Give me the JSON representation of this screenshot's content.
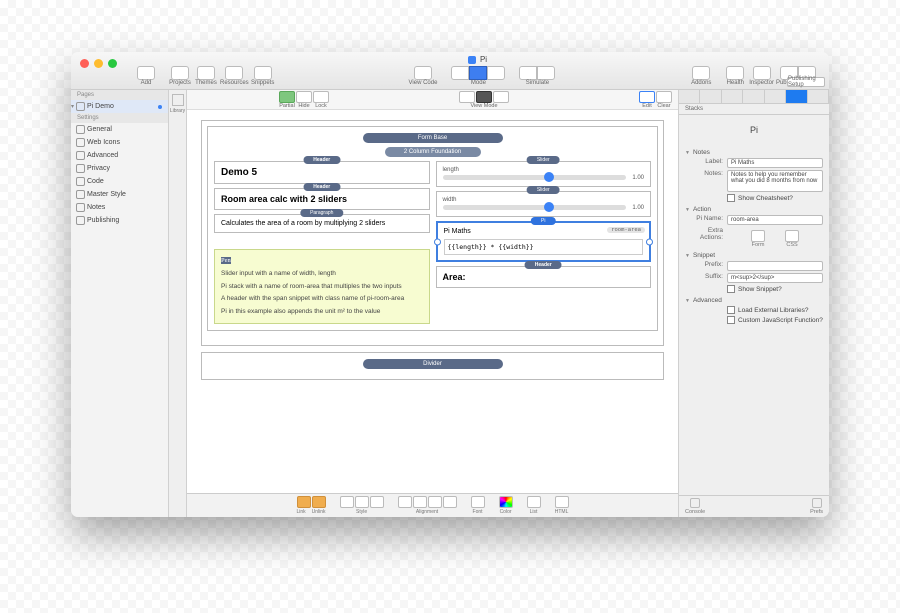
{
  "title": "Pi",
  "toolbar_left": {
    "add": "Add",
    "projects": "Projects",
    "themes": "Themes",
    "resources": "Resources",
    "snippets": "Snippets"
  },
  "toolbar_center": {
    "viewcode": "View Code",
    "mode": "Mode",
    "simulate": "Simulate"
  },
  "toolbar_right": {
    "addons": "Addons",
    "health": "Health",
    "inspector": "Inspector",
    "pubset": "Publishing Setup",
    "publish": "Publish"
  },
  "topright_tabs": [
    "Publishing Setup",
    "Publishing Setup"
  ],
  "sidebar": {
    "pages_hd": "Pages",
    "page_item": "Pi Demo",
    "settings_hd": "Settings",
    "items": [
      "General",
      "Web Icons",
      "Advanced",
      "Privacy",
      "Code",
      "Master Style",
      "Notes",
      "Publishing"
    ]
  },
  "library_label": "Library",
  "canvas_toolbar": {
    "partial": "Partial",
    "hide": "Hide",
    "lock": "Lock",
    "viewmode": "View Mode",
    "edit": "Edit",
    "clear": "Clear"
  },
  "stacks_label": "Stacks",
  "page": {
    "form_base": "Form Base",
    "two_col": "2 Column Foundation",
    "headers": {
      "h": "Header",
      "p": "Paragraph",
      "slider": "Slider",
      "pi": "Pi",
      "pen": "Pen",
      "div": "Divider"
    },
    "demo_heading": "Demo 5",
    "subheading": "Room area calc with 2 sliders",
    "paragraph": "Calculates the area of a room by multiplying 2 sliders",
    "slider1": {
      "label": "length",
      "value": "1.00"
    },
    "slider2": {
      "label": "width",
      "value": "1.00"
    },
    "pi_block": {
      "title": "Pi Maths",
      "badge": "room-area",
      "expr": "{{length}} * {{width}}"
    },
    "area_heading": "Area:",
    "pen_lines": [
      "Slider input with a name of width, length",
      "Pi stack with a name of room-area that multiples the two inputs",
      "A header with the span snippet with class name of pi-room-area",
      "Pi in this example also appends the unit m² to the value"
    ]
  },
  "stylebar": {
    "link": "Link",
    "unlink": "Unlink",
    "style": "Style",
    "alignment": "Alignment",
    "font": "Font",
    "color": "Color",
    "list": "List",
    "html": "HTML"
  },
  "inspector": {
    "title": "Pi",
    "sections": {
      "notes": "Notes",
      "action": "Action",
      "snippet": "Snippet",
      "advanced": "Advanced"
    },
    "notes": {
      "label_lbl": "Label:",
      "label_val": "Pi Maths",
      "notes_lbl": "Notes:",
      "notes_val": "Notes to help you remember what you did 8 months from now",
      "cheat": "Show Cheatsheet?"
    },
    "action": {
      "piname_lbl": "Pi Name:",
      "piname_val": "room-area",
      "extra_lbl": "Extra Actions:",
      "form": "Form",
      "css": "CSS"
    },
    "snippet": {
      "prefix_lbl": "Prefix:",
      "prefix_val": "",
      "suffix_lbl": "Suffix:",
      "suffix_val": "m<sup>2</sup>",
      "show": "Show Snippet?"
    },
    "advanced": {
      "ext": "Load External Libraries?",
      "cust": "Custom JavaScript Function?"
    },
    "footer": {
      "console": "Console",
      "prefs": "Prefs"
    }
  }
}
